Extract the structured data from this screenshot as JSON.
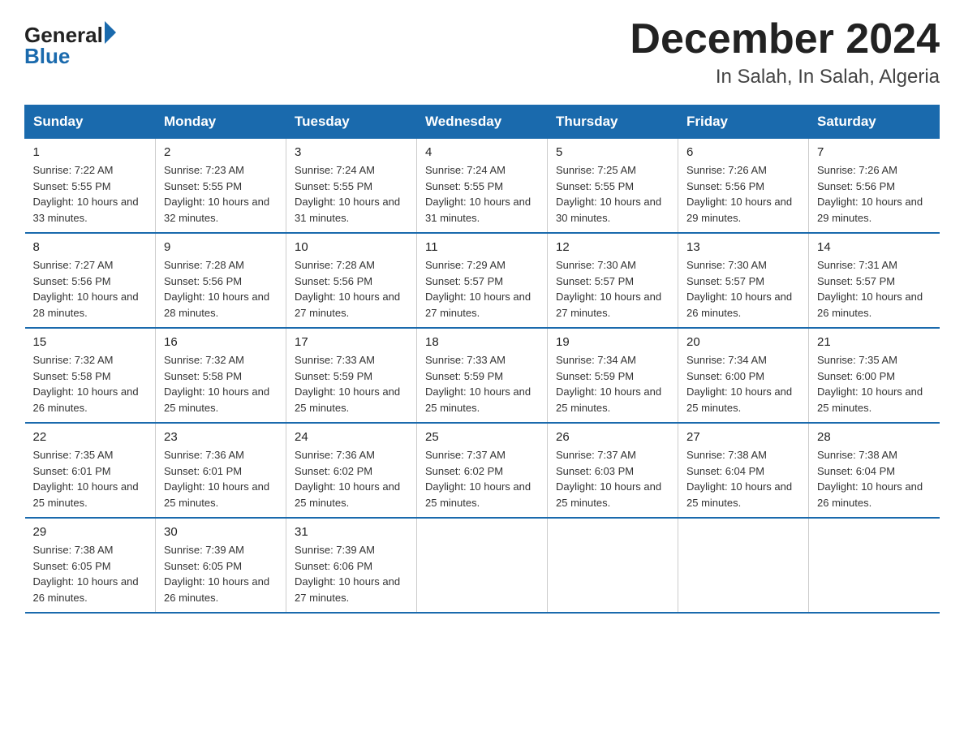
{
  "logo": {
    "text_general": "General",
    "text_blue": "Blue",
    "arrow_symbol": "▶"
  },
  "title": "December 2024",
  "subtitle": "In Salah, In Salah, Algeria",
  "days_of_week": [
    "Sunday",
    "Monday",
    "Tuesday",
    "Wednesday",
    "Thursday",
    "Friday",
    "Saturday"
  ],
  "weeks": [
    [
      {
        "day": 1,
        "sunrise": "7:22 AM",
        "sunset": "5:55 PM",
        "daylight": "10 hours and 33 minutes."
      },
      {
        "day": 2,
        "sunrise": "7:23 AM",
        "sunset": "5:55 PM",
        "daylight": "10 hours and 32 minutes."
      },
      {
        "day": 3,
        "sunrise": "7:24 AM",
        "sunset": "5:55 PM",
        "daylight": "10 hours and 31 minutes."
      },
      {
        "day": 4,
        "sunrise": "7:24 AM",
        "sunset": "5:55 PM",
        "daylight": "10 hours and 31 minutes."
      },
      {
        "day": 5,
        "sunrise": "7:25 AM",
        "sunset": "5:55 PM",
        "daylight": "10 hours and 30 minutes."
      },
      {
        "day": 6,
        "sunrise": "7:26 AM",
        "sunset": "5:56 PM",
        "daylight": "10 hours and 29 minutes."
      },
      {
        "day": 7,
        "sunrise": "7:26 AM",
        "sunset": "5:56 PM",
        "daylight": "10 hours and 29 minutes."
      }
    ],
    [
      {
        "day": 8,
        "sunrise": "7:27 AM",
        "sunset": "5:56 PM",
        "daylight": "10 hours and 28 minutes."
      },
      {
        "day": 9,
        "sunrise": "7:28 AM",
        "sunset": "5:56 PM",
        "daylight": "10 hours and 28 minutes."
      },
      {
        "day": 10,
        "sunrise": "7:28 AM",
        "sunset": "5:56 PM",
        "daylight": "10 hours and 27 minutes."
      },
      {
        "day": 11,
        "sunrise": "7:29 AM",
        "sunset": "5:57 PM",
        "daylight": "10 hours and 27 minutes."
      },
      {
        "day": 12,
        "sunrise": "7:30 AM",
        "sunset": "5:57 PM",
        "daylight": "10 hours and 27 minutes."
      },
      {
        "day": 13,
        "sunrise": "7:30 AM",
        "sunset": "5:57 PM",
        "daylight": "10 hours and 26 minutes."
      },
      {
        "day": 14,
        "sunrise": "7:31 AM",
        "sunset": "5:57 PM",
        "daylight": "10 hours and 26 minutes."
      }
    ],
    [
      {
        "day": 15,
        "sunrise": "7:32 AM",
        "sunset": "5:58 PM",
        "daylight": "10 hours and 26 minutes."
      },
      {
        "day": 16,
        "sunrise": "7:32 AM",
        "sunset": "5:58 PM",
        "daylight": "10 hours and 25 minutes."
      },
      {
        "day": 17,
        "sunrise": "7:33 AM",
        "sunset": "5:59 PM",
        "daylight": "10 hours and 25 minutes."
      },
      {
        "day": 18,
        "sunrise": "7:33 AM",
        "sunset": "5:59 PM",
        "daylight": "10 hours and 25 minutes."
      },
      {
        "day": 19,
        "sunrise": "7:34 AM",
        "sunset": "5:59 PM",
        "daylight": "10 hours and 25 minutes."
      },
      {
        "day": 20,
        "sunrise": "7:34 AM",
        "sunset": "6:00 PM",
        "daylight": "10 hours and 25 minutes."
      },
      {
        "day": 21,
        "sunrise": "7:35 AM",
        "sunset": "6:00 PM",
        "daylight": "10 hours and 25 minutes."
      }
    ],
    [
      {
        "day": 22,
        "sunrise": "7:35 AM",
        "sunset": "6:01 PM",
        "daylight": "10 hours and 25 minutes."
      },
      {
        "day": 23,
        "sunrise": "7:36 AM",
        "sunset": "6:01 PM",
        "daylight": "10 hours and 25 minutes."
      },
      {
        "day": 24,
        "sunrise": "7:36 AM",
        "sunset": "6:02 PM",
        "daylight": "10 hours and 25 minutes."
      },
      {
        "day": 25,
        "sunrise": "7:37 AM",
        "sunset": "6:02 PM",
        "daylight": "10 hours and 25 minutes."
      },
      {
        "day": 26,
        "sunrise": "7:37 AM",
        "sunset": "6:03 PM",
        "daylight": "10 hours and 25 minutes."
      },
      {
        "day": 27,
        "sunrise": "7:38 AM",
        "sunset": "6:04 PM",
        "daylight": "10 hours and 25 minutes."
      },
      {
        "day": 28,
        "sunrise": "7:38 AM",
        "sunset": "6:04 PM",
        "daylight": "10 hours and 26 minutes."
      }
    ],
    [
      {
        "day": 29,
        "sunrise": "7:38 AM",
        "sunset": "6:05 PM",
        "daylight": "10 hours and 26 minutes."
      },
      {
        "day": 30,
        "sunrise": "7:39 AM",
        "sunset": "6:05 PM",
        "daylight": "10 hours and 26 minutes."
      },
      {
        "day": 31,
        "sunrise": "7:39 AM",
        "sunset": "6:06 PM",
        "daylight": "10 hours and 27 minutes."
      },
      null,
      null,
      null,
      null
    ]
  ]
}
